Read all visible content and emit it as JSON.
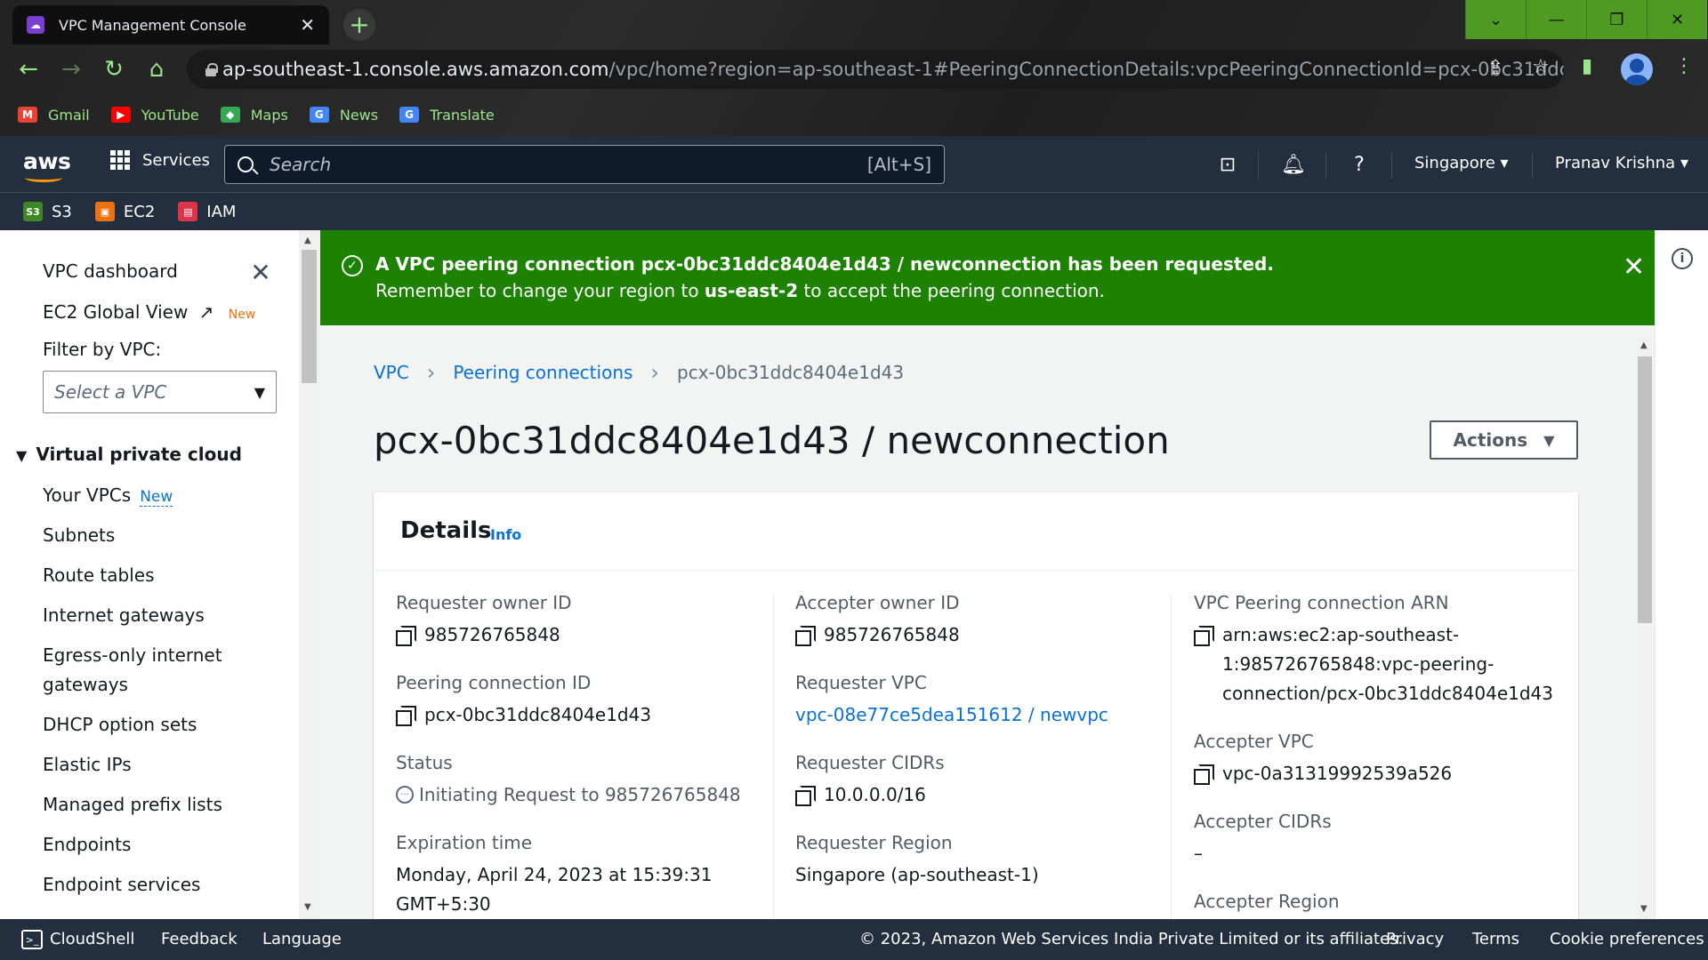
{
  "browser": {
    "tab_title": "VPC Management Console",
    "url_domain": "ap-southeast-1.console.aws.amazon.com",
    "url_path": "/vpc/home?region=ap-southeast-1#PeeringConnectionDetails:vpcPeeringConnectionId=pcx-0bc31ddc8404...",
    "bookmarks": [
      {
        "label": "Gmail",
        "icon": "gmail-icon",
        "color": "#ea4335"
      },
      {
        "label": "YouTube",
        "icon": "youtube-icon",
        "color": "#ff0000"
      },
      {
        "label": "Maps",
        "icon": "maps-icon",
        "color": "#34a853"
      },
      {
        "label": "News",
        "icon": "news-icon",
        "color": "#4285f4"
      },
      {
        "label": "Translate",
        "icon": "translate-icon",
        "color": "#4285f4"
      }
    ],
    "accent_color": "#4e9a22"
  },
  "aws_nav": {
    "logo": "aws",
    "services_label": "Services",
    "search_placeholder": "Search",
    "search_shortcut": "[Alt+S]",
    "region": "Singapore",
    "user": "Pranav Krishna",
    "favorites": [
      {
        "label": "S3",
        "icon": "s3-icon",
        "color": "#3f8624"
      },
      {
        "label": "EC2",
        "icon": "ec2-icon",
        "color": "#ec7211"
      },
      {
        "label": "IAM",
        "icon": "iam-icon",
        "color": "#dd344c"
      }
    ]
  },
  "sidebar": {
    "dashboard": "VPC dashboard",
    "ec2_global_view": "EC2 Global View",
    "new_badge": "New",
    "filter_label": "Filter by VPC:",
    "vpc_select_placeholder": "Select a VPC",
    "section_title": "Virtual private cloud",
    "your_vpcs": "Your VPCs",
    "your_vpcs_badge": "New",
    "items": [
      "Subnets",
      "Route tables",
      "Internet gateways",
      "Egress-only internet",
      "gateways",
      "DHCP option sets",
      "Elastic IPs",
      "Managed prefix lists",
      "Endpoints",
      "Endpoint services"
    ]
  },
  "flash": {
    "line1": "A VPC peering connection pcx-0bc31ddc8404e1d43 / newconnection has been requested.",
    "line2_pre": "Remember to change your region to ",
    "line2_region": "us-east-2",
    "line2_post": " to accept the peering connection.",
    "color": "#1d8102"
  },
  "breadcrumb": {
    "items": [
      "VPC",
      "Peering connections"
    ],
    "current": "pcx-0bc31ddc8404e1d43"
  },
  "page_title": "pcx-0bc31ddc8404e1d43 / newconnection",
  "actions_label": "Actions",
  "details": {
    "heading": "Details",
    "info_label": "Info",
    "col1": {
      "requester_owner_id_label": "Requester owner ID",
      "requester_owner_id": "985726765848",
      "peering_connection_id_label": "Peering connection ID",
      "peering_connection_id": "pcx-0bc31ddc8404e1d43",
      "status_label": "Status",
      "status": "Initiating Request to 985726765848",
      "expiration_label": "Expiration time",
      "expiration_line1": "Monday, April 24, 2023 at 15:39:31",
      "expiration_line2": "GMT+5:30"
    },
    "col2": {
      "accepter_owner_id_label": "Accepter owner ID",
      "accepter_owner_id": "985726765848",
      "requester_vpc_label": "Requester VPC",
      "requester_vpc": "vpc-08e77ce5dea151612 / newvpc",
      "requester_cidrs_label": "Requester CIDRs",
      "requester_cidrs": "10.0.0.0/16",
      "requester_region_label": "Requester Region",
      "requester_region": "Singapore (ap-southeast-1)"
    },
    "col3": {
      "arn_label": "VPC Peering connection ARN",
      "arn_line1": "arn:aws:ec2:ap-southeast-",
      "arn_line2": "1:985726765848:vpc-peering-",
      "arn_line3": "connection/pcx-0bc31ddc8404e1d43",
      "accepter_vpc_label": "Accepter VPC",
      "accepter_vpc": "vpc-0a31319992539a526",
      "accepter_cidrs_label": "Accepter CIDRs",
      "accepter_cidrs": "–",
      "accepter_region_label": "Accepter Region"
    }
  },
  "footer": {
    "cloudshell": "CloudShell",
    "feedback": "Feedback",
    "language": "Language",
    "copyright": "© 2023, Amazon Web Services India Private Limited or its affiliates.",
    "privacy": "Privacy",
    "terms": "Terms",
    "cookie": "Cookie preferences"
  }
}
